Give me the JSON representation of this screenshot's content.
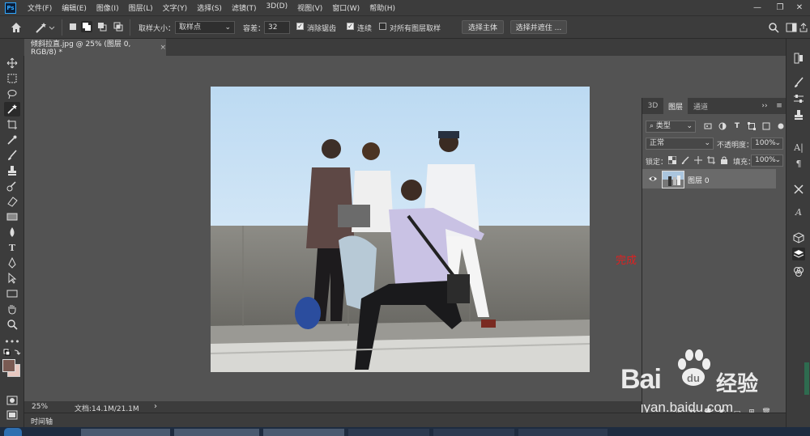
{
  "app": {
    "logo_text": "Ps",
    "menu": [
      "文件(F)",
      "编辑(E)",
      "图像(I)",
      "图层(L)",
      "文字(Y)",
      "选择(S)",
      "滤镜(T)",
      "3D(D)",
      "视图(V)",
      "窗口(W)",
      "帮助(H)"
    ],
    "window_controls": [
      "—",
      "❐",
      "✕"
    ]
  },
  "options_bar": {
    "sample_size_label": "取样大小：",
    "sample_size_value": "取样点",
    "tolerance_label": "容差：",
    "tolerance_value": "32",
    "antialias_label": "消除锯齿",
    "antialias_checked": true,
    "contiguous_label": "连续",
    "contiguous_checked": true,
    "all_layers_label": "对所有图层取样",
    "all_layers_checked": false,
    "select_subject_button": "选择主体",
    "select_mask_button": "选择并遮住 ..."
  },
  "document": {
    "tab_title": "倾斜拉直.jpg @ 25% (图层 0, RGB/8) *",
    "zoom": "25%",
    "doc_info": "文档:14.1M/21.1M"
  },
  "timeline_label": "时间轴",
  "layers_panel": {
    "tabs": [
      "3D",
      "图层",
      "通道"
    ],
    "active_tab": "图层",
    "filter_kind": "类型",
    "blend_mode": "正常",
    "opacity_label": "不透明度：",
    "opacity_value": "100%",
    "lock_label": "锁定：",
    "fill_label": "填充：",
    "fill_value": "100%",
    "layers": [
      {
        "name": "图层 0",
        "visible": true
      }
    ]
  },
  "annotation": {
    "text": "完成",
    "color": "#e02020"
  },
  "watermark": {
    "brand": "Bai",
    "brand_suffix": "经验",
    "url": "jingyan.baidu.com"
  },
  "colors": {
    "workspace": "#535353",
    "chrome": "#3c3c3c",
    "foreground_swatch": "#7a5a52",
    "background_swatch": "#e8c8c0"
  }
}
